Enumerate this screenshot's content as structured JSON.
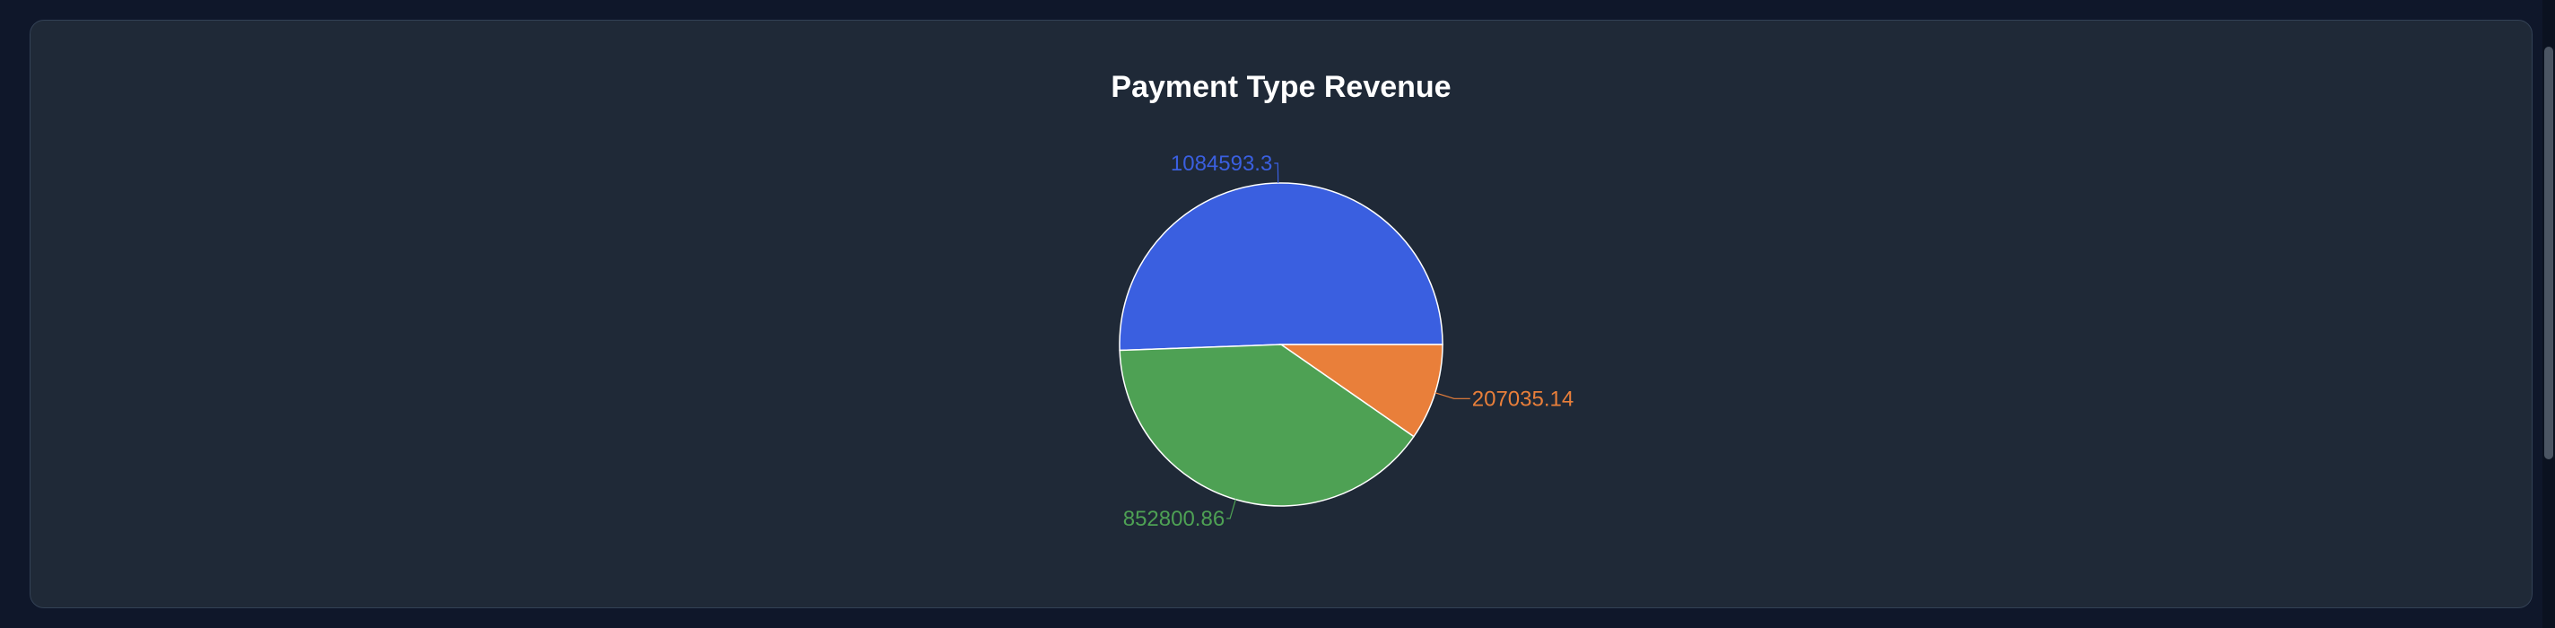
{
  "chart_data": {
    "type": "pie",
    "title": "Payment Type Revenue",
    "slices": [
      {
        "label": "1084593.3",
        "value": 1084593.3,
        "color": "#3a5fe0"
      },
      {
        "label": "207035.14",
        "value": 207035.14,
        "color": "#e97f3a"
      },
      {
        "label": "852800.86",
        "value": 852800.86,
        "color": "#4ea154"
      }
    ]
  }
}
